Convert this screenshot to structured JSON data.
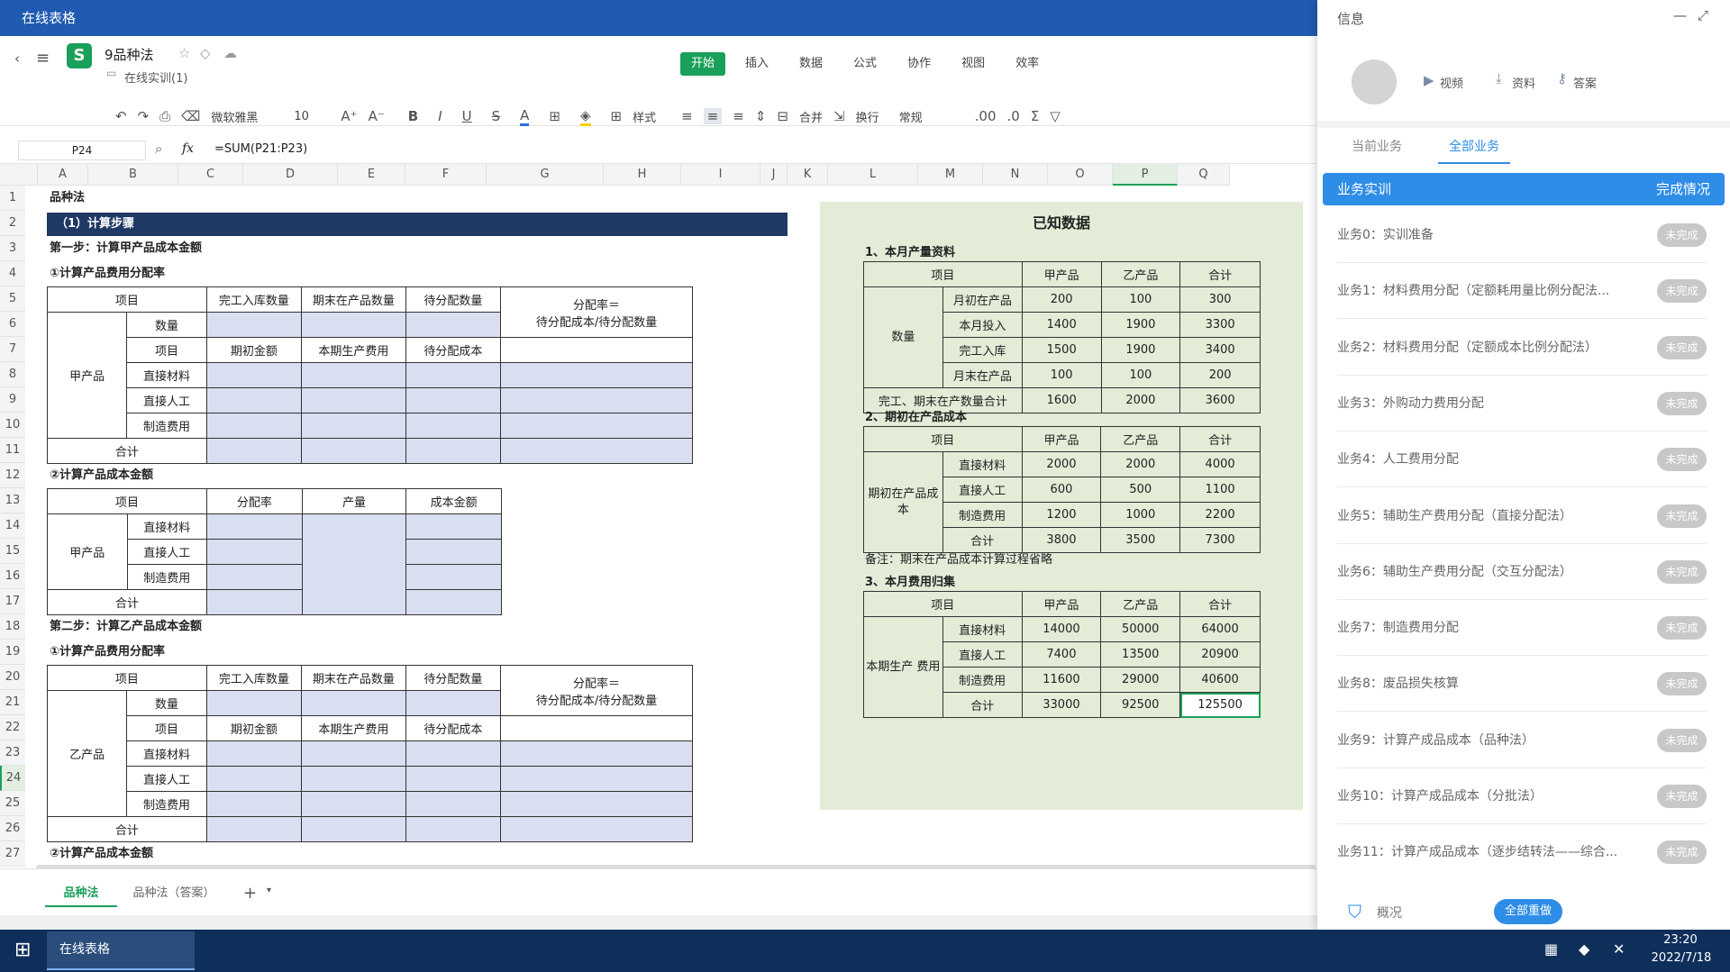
{
  "window": {
    "title": "在线表格"
  },
  "doc": {
    "name": "9品种法",
    "folder": "在线实训(1)"
  },
  "menu": {
    "items": [
      "开始",
      "插入",
      "数据",
      "公式",
      "协作",
      "视图",
      "效率"
    ],
    "active": 0
  },
  "toolbar": {
    "font": "微软雅黑",
    "size": "10",
    "style_label": "样式",
    "merge_label": "合并",
    "wrap_label": "换行",
    "format": "常规"
  },
  "formula": {
    "cell_ref": "P24",
    "fx": "fx",
    "content": "=SUM(P21:P23)"
  },
  "columns": [
    "A",
    "B",
    "C",
    "D",
    "E",
    "F",
    "G",
    "H",
    "I",
    "J",
    "K",
    "L",
    "M",
    "N",
    "O",
    "P",
    "Q"
  ],
  "rows": [
    "1",
    "2",
    "3",
    "4",
    "5",
    "6",
    "7",
    "8",
    "9",
    "10",
    "11",
    "12",
    "13",
    "14",
    "15",
    "16",
    "17",
    "18",
    "19",
    "20",
    "21",
    "22",
    "23",
    "24",
    "25",
    "26",
    "27"
  ],
  "sheet": {
    "r1": "品种法",
    "r2": "（1）计算步骤",
    "r3": "第一步：计算甲产品成本金额",
    "r4": "①计算产品费用分配率",
    "r12": "②计算产品成本金额",
    "r18": "第二步：计算乙产品成本金额",
    "r19": "①计算产品费用分配率",
    "r27": "②计算产品成本金额",
    "t1": {
      "item": "项目",
      "done": "完工入库数量",
      "wip": "期末在产品数量",
      "alloc_qty": "待分配数量",
      "rate1": "分配率＝",
      "rate2": "待分配成本/待分配数量",
      "qty": "数量",
      "item2": "项目",
      "opening": "期初金额",
      "current": "本期生产费用",
      "alloc_cost": "待分配成本",
      "mat": "直接材料",
      "labor": "直接人工",
      "mfg": "制造费用",
      "total": "合计",
      "product_a": "甲产品",
      "product_b": "乙产品"
    },
    "t2": {
      "item": "项目",
      "rate": "分配率",
      "output": "产量",
      "cost": "成本金额"
    }
  },
  "known": {
    "title": "已知数据",
    "s1": "1、本月产量资料",
    "s2": "2、期初在产品成本",
    "s3": "3、本月费用归集",
    "h": [
      "项目",
      "甲产品",
      "乙产品",
      "合计"
    ],
    "qty_label": "数量",
    "qty_rows": [
      [
        "月初在产品",
        "200",
        "100",
        "300"
      ],
      [
        "本月投入",
        "1400",
        "1900",
        "3300"
      ],
      [
        "完工入库",
        "1500",
        "1900",
        "3400"
      ],
      [
        "月末在产品",
        "100",
        "100",
        "200"
      ]
    ],
    "qty_total": [
      "完工、期末在产数量合计",
      "1600",
      "2000",
      "3600"
    ],
    "wip_label": "期初在产品成本",
    "wip_rows": [
      [
        "直接材料",
        "2000",
        "2000",
        "4000"
      ],
      [
        "直接人工",
        "600",
        "500",
        "1100"
      ],
      [
        "制造费用",
        "1200",
        "1000",
        "2200"
      ],
      [
        "合计",
        "3800",
        "3500",
        "7300"
      ]
    ],
    "note": "备注：期末在产品成本计算过程省略",
    "cur_label": "本期生产 费用",
    "cur_rows": [
      [
        "直接材料",
        "14000",
        "50000",
        "64000"
      ],
      [
        "直接人工",
        "7400",
        "13500",
        "20900"
      ],
      [
        "制造费用",
        "11600",
        "29000",
        "40600"
      ],
      [
        "合计",
        "33000",
        "92500",
        "125500"
      ]
    ]
  },
  "tabs": [
    "品种法",
    "品种法（答案）"
  ],
  "panel": {
    "title": "信息",
    "actions": [
      "视频",
      "资料",
      "答案"
    ],
    "tabs": [
      "当前业务",
      "全部业务"
    ],
    "header_left": "业务实训",
    "header_right": "完成情况",
    "tasks": [
      "业务0：实训准备",
      "业务1：材料费用分配（定额耗用量比例分配法...",
      "业务2：材料费用分配（定额成本比例分配法）",
      "业务3：外购动力费用分配",
      "业务4：人工费用分配",
      "业务5：辅助生产费用分配（直接分配法）",
      "业务6：辅助生产费用分配（交互分配法）",
      "业务7：制造费用分配",
      "业务8：废品损失核算",
      "业务9：计算产成品成本（品种法）",
      "业务10：计算产成品成本（分批法）",
      "业务11：计算产成品成本（逐步结转法——综合..."
    ],
    "status": "未完成",
    "footer_left": "概况",
    "footer_btn": "全部重做"
  },
  "taskbar": {
    "app": "在线表格",
    "time": "23:20",
    "date": "2022/7/18"
  },
  "colors": {
    "titlebar": "#1f5bb0",
    "accent": "#2e8de6",
    "known_bg": "#e2ecd7",
    "header_dark": "#1f3864",
    "fill": "#d9dff0",
    "taskbar": "#0f2f5b"
  }
}
